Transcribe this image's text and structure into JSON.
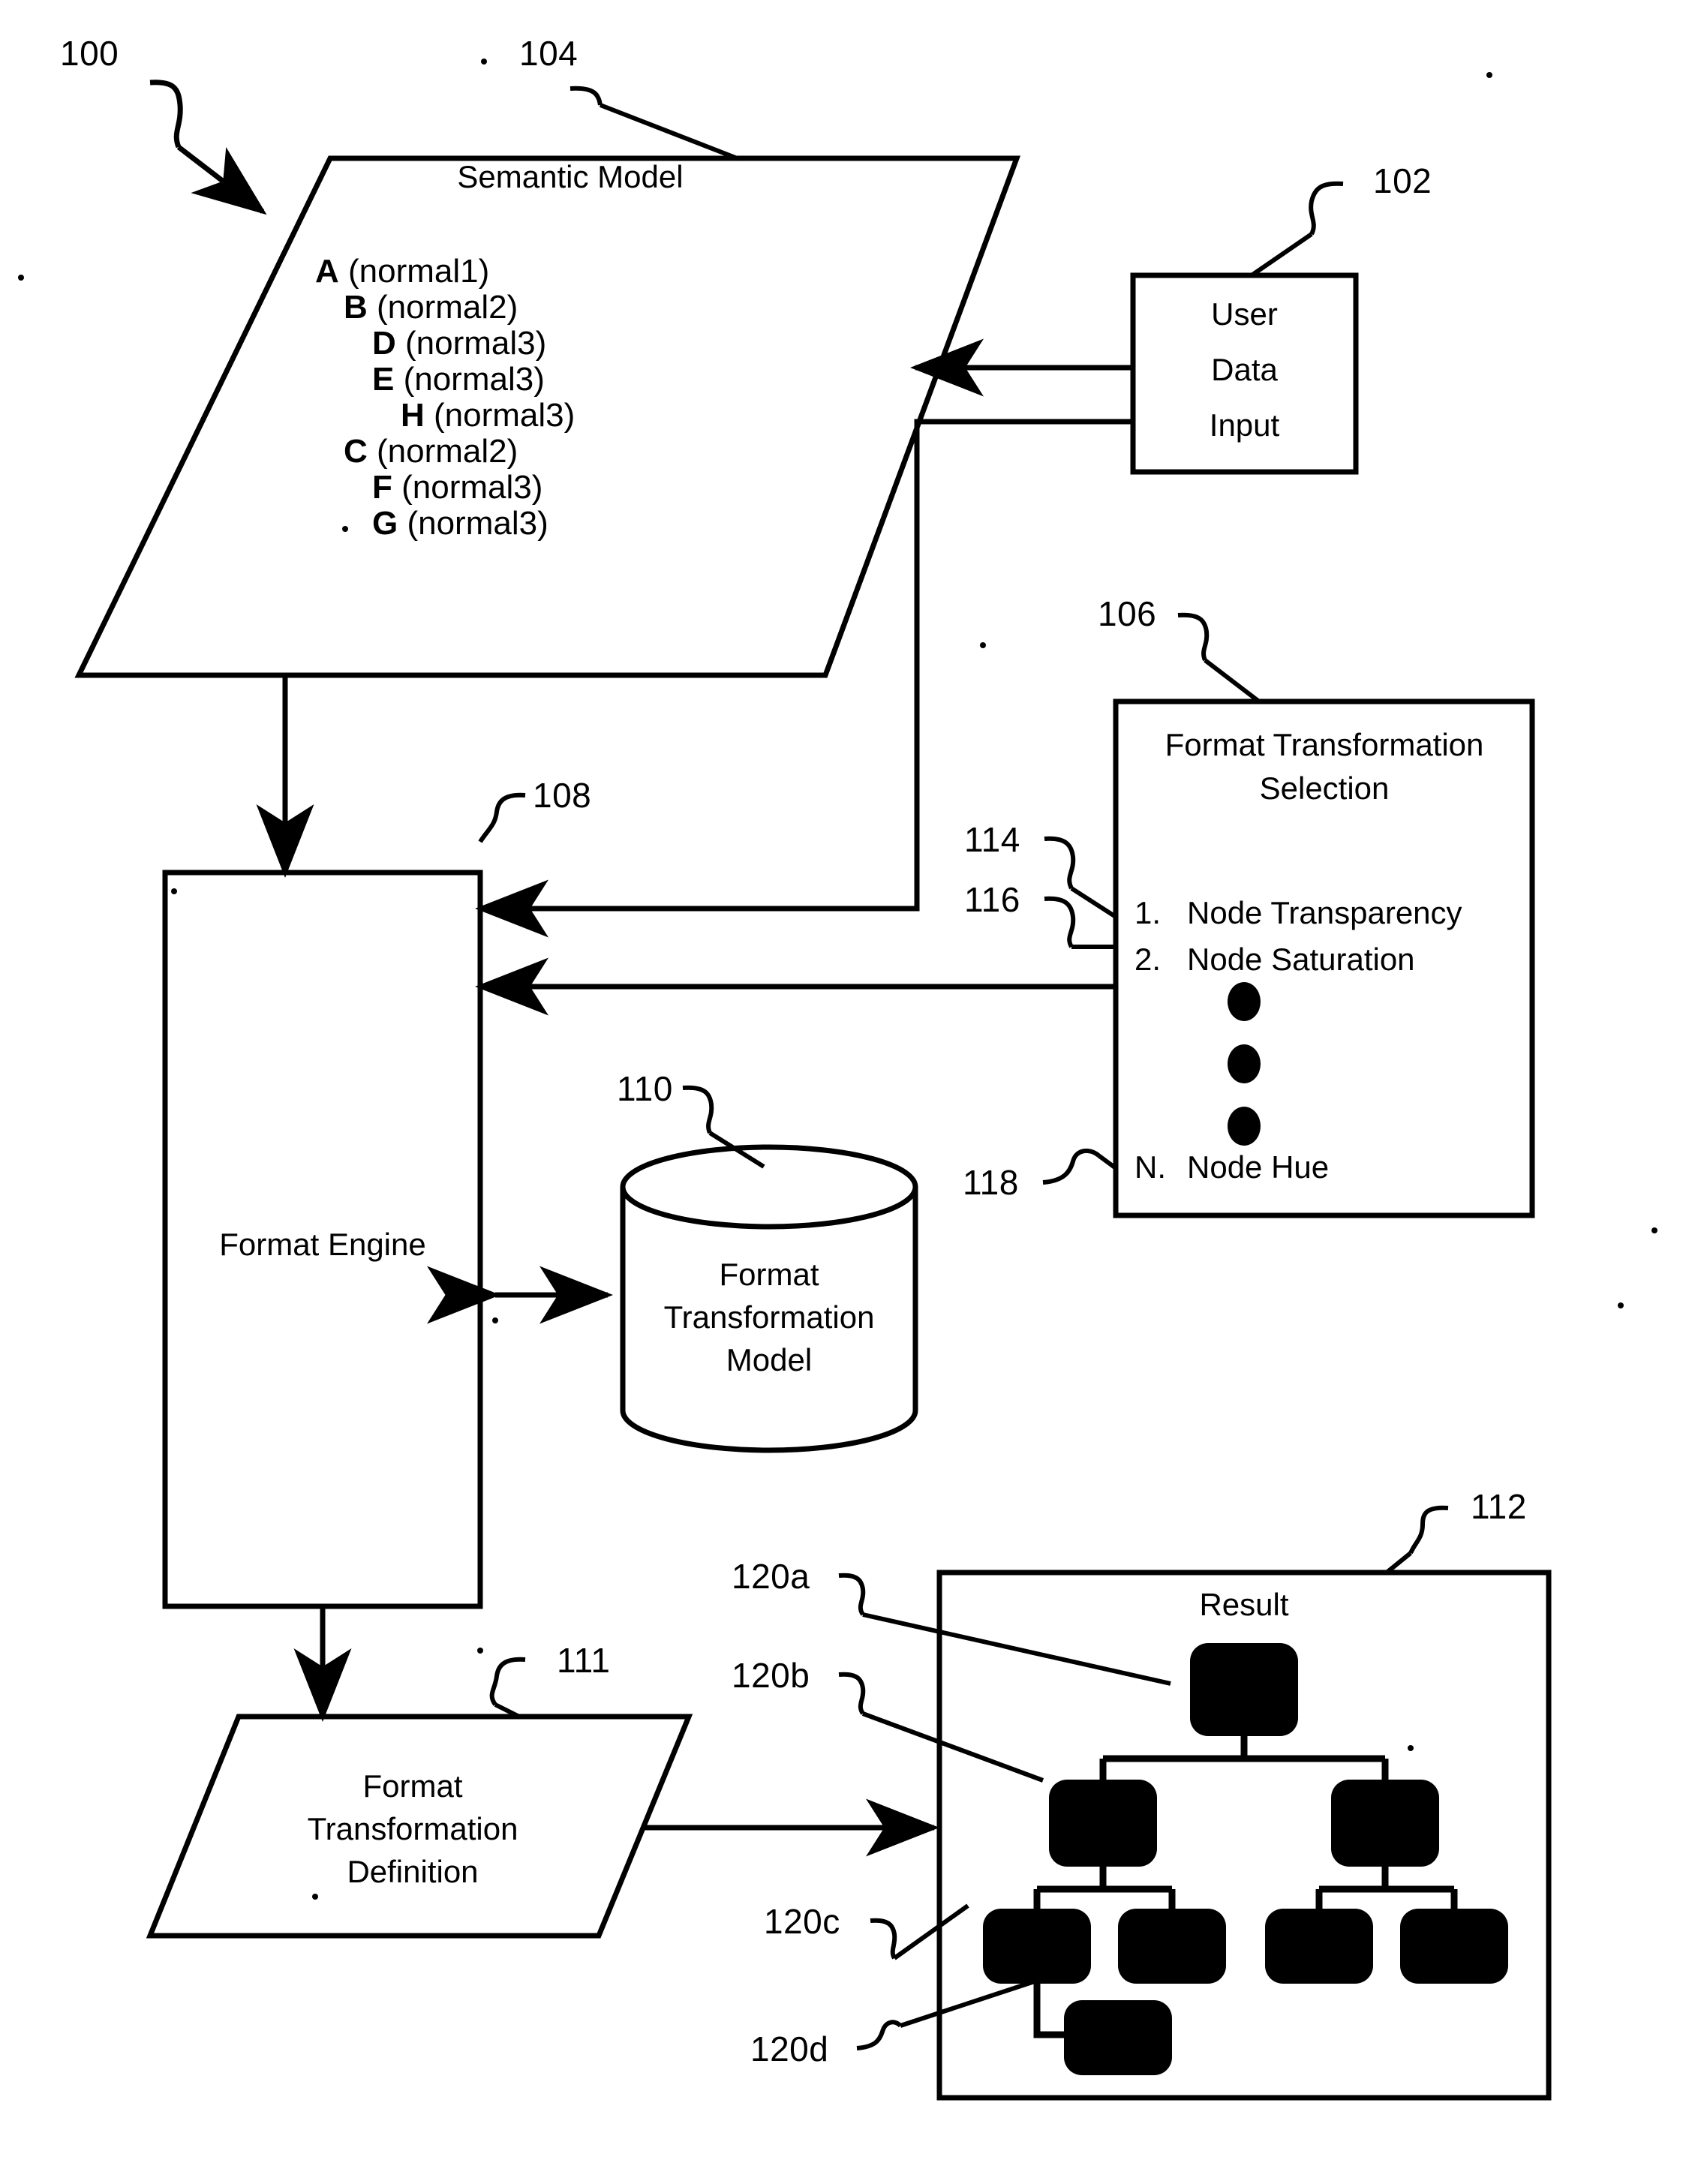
{
  "figure": {
    "system_ref": "100",
    "semantic_model": {
      "ref": "104",
      "title": "Semantic Model",
      "tree": [
        {
          "indent": 0,
          "node": "A",
          "normal": "(normal1)"
        },
        {
          "indent": 1,
          "node": "B",
          "normal": "(normal2)"
        },
        {
          "indent": 2,
          "node": "D",
          "normal": "(normal3)"
        },
        {
          "indent": 2,
          "node": "E",
          "normal": "(normal3)"
        },
        {
          "indent": 3,
          "node": "H",
          "normal": "(normal3)"
        },
        {
          "indent": 1,
          "node": "C",
          "normal": "(normal2)"
        },
        {
          "indent": 2,
          "node": "F",
          "normal": "(normal3)"
        },
        {
          "indent": 2,
          "node": "G",
          "normal": "(normal3)"
        }
      ]
    },
    "user_data_input": {
      "ref": "102",
      "lines": [
        "User",
        "Data",
        "Input"
      ]
    },
    "format_transformation_selection": {
      "ref": "106",
      "title_lines": [
        "Format Transformation",
        "Selection"
      ],
      "items": [
        {
          "ref": "114",
          "number": "1.",
          "label": "Node Transparency"
        },
        {
          "ref": "116",
          "number": "2.",
          "label": "Node Saturation"
        },
        {
          "ref": "118",
          "number": "N.",
          "label": "Node Hue"
        }
      ],
      "ellipsis_dots": 3
    },
    "format_engine": {
      "ref": "108",
      "label": "Format Engine"
    },
    "format_transformation_model": {
      "ref": "110",
      "lines": [
        "Format",
        "Transformation",
        "Model"
      ]
    },
    "format_transformation_definition": {
      "ref": "111",
      "lines": [
        "Format",
        "Transformation",
        "Definition"
      ]
    },
    "result": {
      "ref": "112",
      "title": "Result",
      "node_refs": [
        "120a",
        "120b",
        "120c",
        "120d"
      ],
      "node_fill": "#000000",
      "nodes": [
        {
          "id": "120a",
          "level": 0
        },
        {
          "id": "120b",
          "level": 1
        },
        {
          "id": "120c",
          "level": 2
        },
        {
          "id": "120d",
          "level": 3
        }
      ]
    }
  }
}
